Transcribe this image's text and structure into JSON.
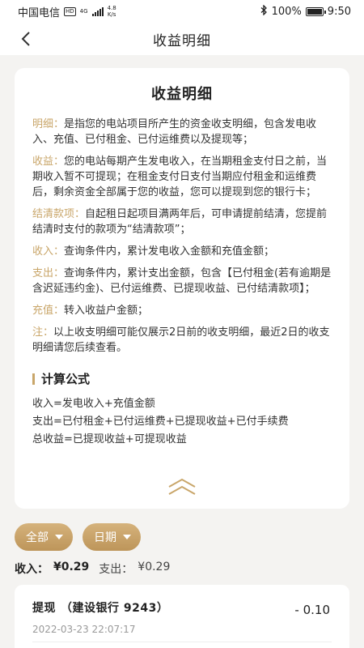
{
  "status_bar": {
    "carrier": "中国电信",
    "hd": "HD",
    "network": "4G",
    "speed_value": "4.8",
    "speed_unit": "K/s",
    "battery": "100%",
    "time": "9:50"
  },
  "nav": {
    "title": "收益明细"
  },
  "card": {
    "title": "收益明细",
    "paragraphs": [
      {
        "key": "明细：",
        "text": "是指您的电站项目所产生的资金收支明细，包含发电收入、充值、已付租金、已付运维费以及提现等；"
      },
      {
        "key": "收益：",
        "text": "您的电站每期产生发电收入，在当期租金支付日之前，当期收入暂不可提现；在租金支付日支付当期应付租金和运维费后，剩余资金全部属于您的收益，您可以提现到您的银行卡；"
      },
      {
        "key": "结清款项：",
        "text": "自起租日起项目满两年后，可申请提前结清，您提前结清时支付的款项为“结清款项”；"
      },
      {
        "key": "收入：",
        "text": "查询条件内，累计发电收入金额和充值金额；"
      },
      {
        "key": "支出：",
        "text": "查询条件内，累计支出金额，包含【已付租金(若有逾期是含迟延违约金)、已付运维费、已提现收益、已付结清款项】；"
      },
      {
        "key": "充值：",
        "text": "转入收益户金额；"
      },
      {
        "key": "注：",
        "text": "以上收支明细可能仅展示2日前的收支明细，最近2日的收支明细请您后续查看。"
      }
    ],
    "formula_heading": "计算公式",
    "formulas": [
      "收入=发电收入+充值金额",
      "支出=已付租金+已付运维费+已提现收益+已付手续费",
      "总收益=已提现收益+可提现收益"
    ]
  },
  "filters": {
    "all_label": "全部",
    "date_label": "日期"
  },
  "summary": {
    "income_label": "收入：",
    "income_value": "¥0.29",
    "expense_label": "支出：",
    "expense_value": "¥0.29"
  },
  "transactions": [
    {
      "type": "提现",
      "bank": "（建设银行 9243）",
      "time": "2022-03-23 22:07:17",
      "amount": "- 0.10"
    }
  ],
  "colors": {
    "accent": "#c9a66a",
    "pill": "#c9a066",
    "background": "#f4f3f1"
  }
}
